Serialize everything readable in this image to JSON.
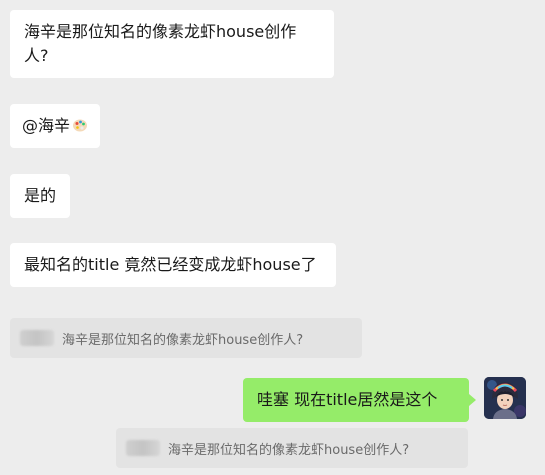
{
  "messages": [
    {
      "text": "海辛是那位知名的像素龙虾house创作人?"
    },
    {
      "text": "@海辛",
      "icon": "palette-emoji-icon"
    },
    {
      "text": "是的"
    },
    {
      "text": "最知名的title 竟然已经变成龙虾house了"
    }
  ],
  "quote1": {
    "text": "海辛是那位知名的像素龙虾house创作人?"
  },
  "self_message": {
    "text": "哇塞 现在title居然是这个"
  },
  "quote2": {
    "text": "海辛是那位知名的像素龙虾house创作人?"
  },
  "colors": {
    "background": "#ededed",
    "bubble_incoming": "#ffffff",
    "bubble_outgoing": "#95ec69",
    "quote_bg": "#e3e3e3"
  }
}
